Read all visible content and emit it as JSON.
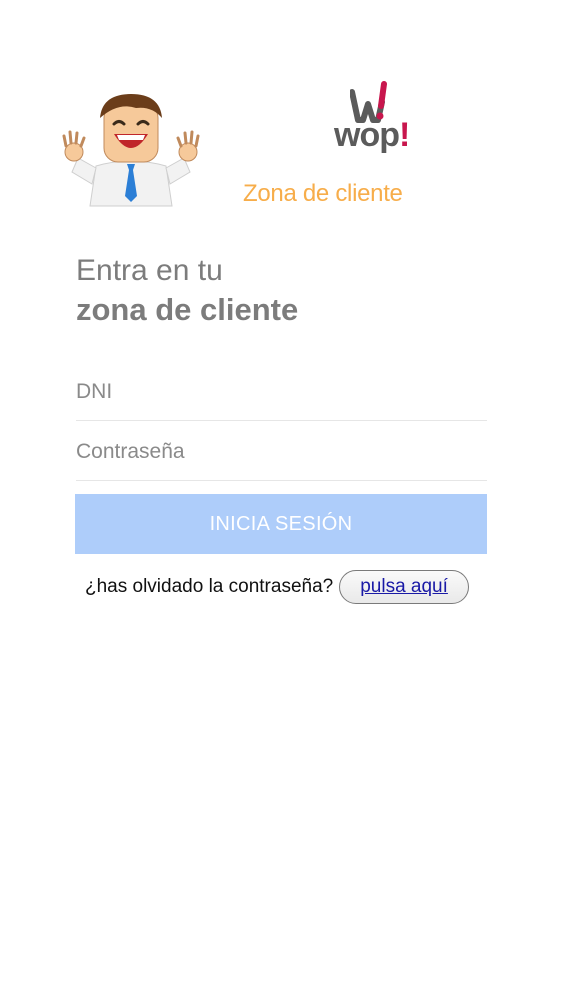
{
  "header": {
    "mascot_icon": "waving-businessman-illustration",
    "brand": {
      "logo_text": "wop",
      "logo_mark": "!",
      "mark_icon": "w-exclamation-logo-icon",
      "accent_color": "#c8164d"
    },
    "zone_label": "Zona de cliente",
    "zone_color": "#f7ad4a"
  },
  "login": {
    "heading_line1": "Entra en tu",
    "heading_line2": "zona de cliente",
    "dni_placeholder": "DNI",
    "password_placeholder": "Contraseña",
    "submit_label": "INICIA SESIÓN",
    "submit_color": "#aecdfa",
    "forgot_text": "¿has olvidado la contraseña?",
    "forgot_link_label": "pulsa aquí"
  }
}
